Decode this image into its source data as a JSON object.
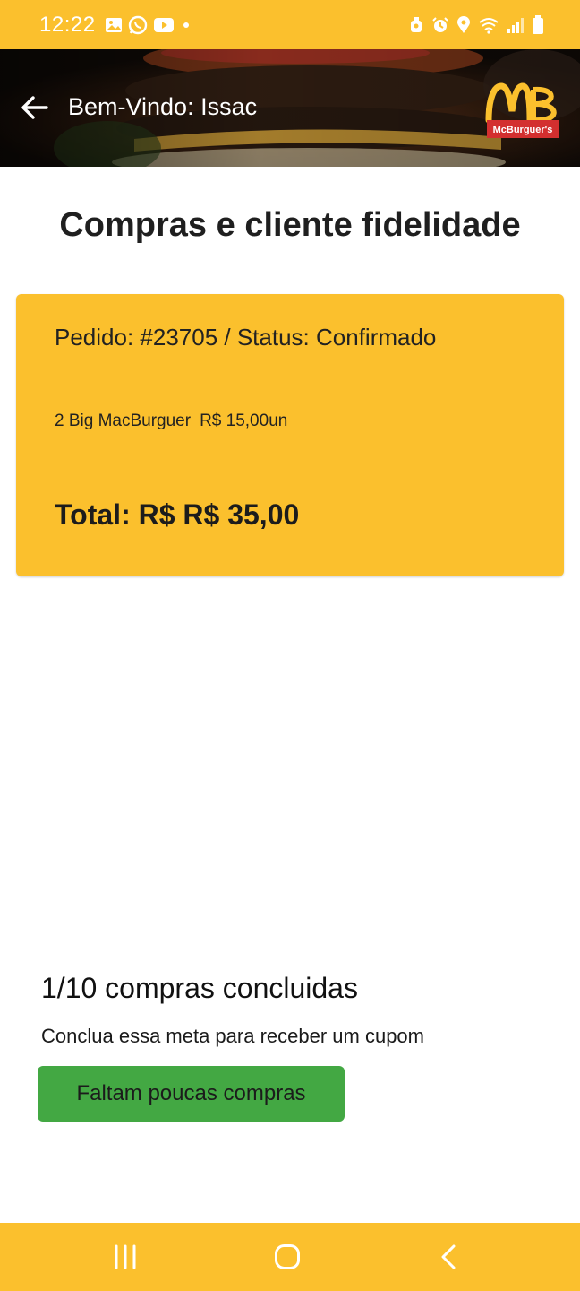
{
  "status_bar": {
    "time": "12:22",
    "left_icons": [
      "gallery-icon",
      "whatsapp-icon",
      "youtube-icon",
      "dot-icon"
    ],
    "right_icons": [
      "cleaner-icon",
      "alarm-icon",
      "location-icon",
      "wifi-icon",
      "signal-icon",
      "battery-icon"
    ]
  },
  "app_bar": {
    "title": "Bem-Vindo: Issac",
    "logo_text": "McBurguer's"
  },
  "page": {
    "title": "Compras e cliente fidelidade"
  },
  "order": {
    "header": "Pedido: #23705 / Status: Confirmado",
    "items": [
      {
        "description": "2 Big MacBurguer",
        "price": "R$ 15,00un"
      }
    ],
    "total": "Total: R$ R$ 35,00"
  },
  "loyalty": {
    "progress_text": "1/10 compras concluidas",
    "completed": 1,
    "goal": 10,
    "note": "Conclua essa meta para receber um cupom",
    "button_label": "Faltam poucas compras"
  },
  "colors": {
    "primary_yellow": "#fbc02d",
    "button_green": "#43a843",
    "logo_red": "#d32f2f"
  }
}
